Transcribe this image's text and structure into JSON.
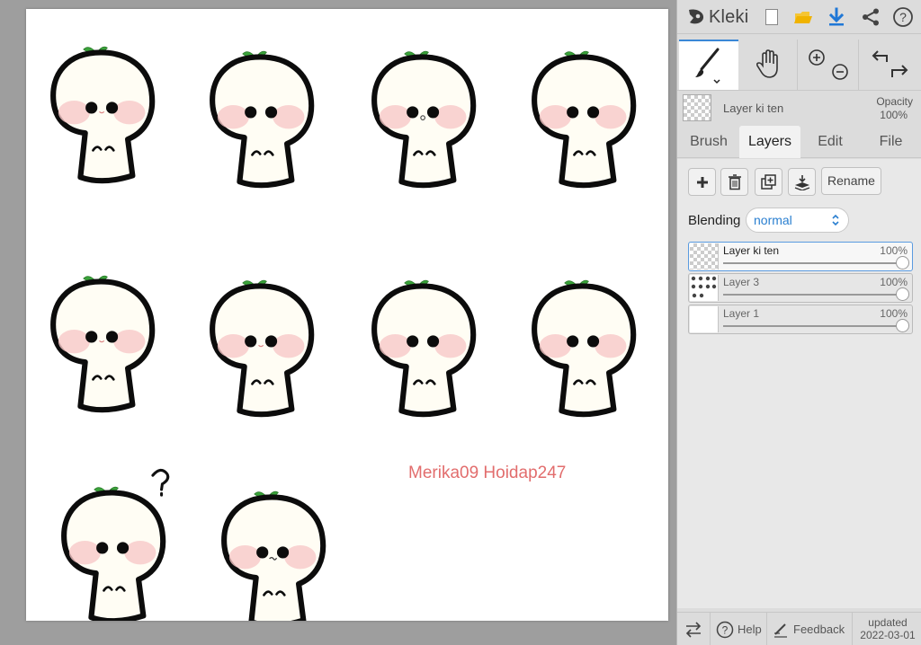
{
  "app": {
    "logo_text": "Kleki"
  },
  "toolbar": {
    "icons": [
      "new-image-icon",
      "open-folder-icon",
      "download-icon",
      "share-icon",
      "help-icon"
    ],
    "colors": {
      "folder": "#f0b300",
      "download": "#1f77d6"
    }
  },
  "tools": {
    "active": "brush",
    "items": [
      "brush",
      "hand",
      "zoom",
      "undo-redo"
    ]
  },
  "current_layer": {
    "name": "Layer ki ten",
    "opacity_label": "Opacity",
    "opacity_value": "100%"
  },
  "tabs": [
    {
      "label": "Brush",
      "active": false
    },
    {
      "label": "Layers",
      "active": true
    },
    {
      "label": "Edit",
      "active": false
    },
    {
      "label": "File",
      "active": false
    }
  ],
  "layers_panel": {
    "rename_label": "Rename",
    "blending_label": "Blending",
    "blending_value": "normal",
    "layers": [
      {
        "name": "Layer ki ten",
        "opacity": "100%",
        "active": true
      },
      {
        "name": "Layer 3",
        "opacity": "100%",
        "active": false
      },
      {
        "name": "Layer 1",
        "opacity": "100%",
        "active": false
      }
    ]
  },
  "footer": {
    "help_label": "Help",
    "feedback_label": "Feedback",
    "updated_label": "updated",
    "updated_date": "2022-03-01"
  },
  "canvas": {
    "watermark": "Merika09 Hoidap247",
    "accent_color": "#e26d6d",
    "figure_count": 10
  }
}
